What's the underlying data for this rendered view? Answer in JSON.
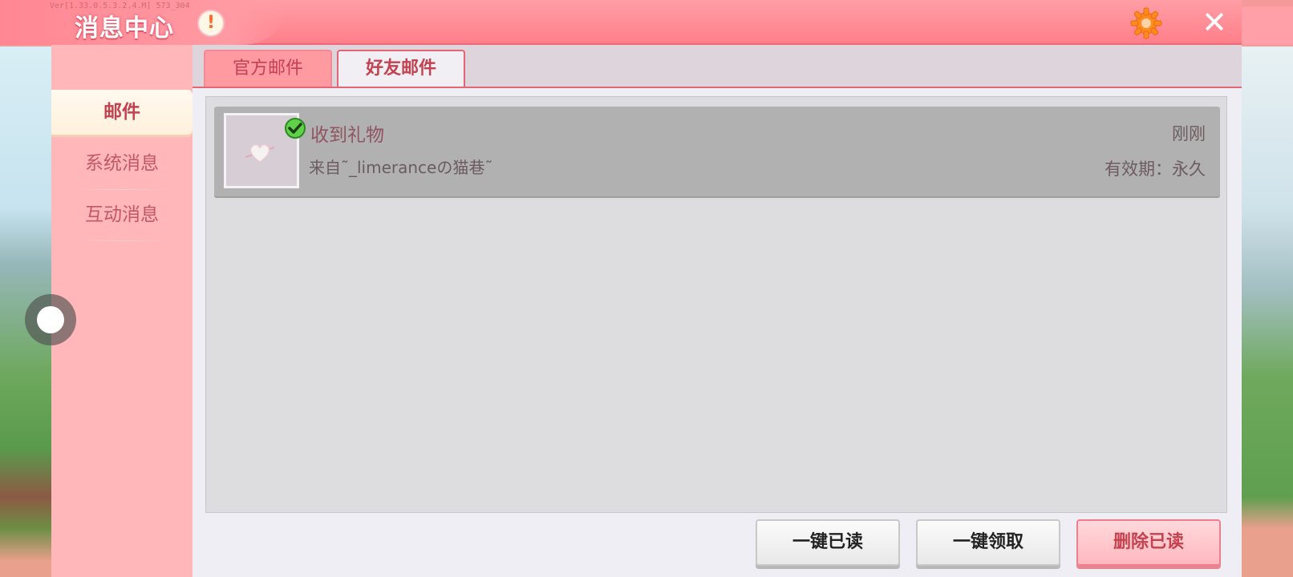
{
  "window": {
    "title": "消息中心",
    "version_text": "Ver[1.33.0.5.3.2.4.M] 573_304",
    "alert_symbol": "!",
    "close_symbol": "✕"
  },
  "sidebar": {
    "items": [
      {
        "label": "邮件",
        "active": true
      },
      {
        "label": "系统消息",
        "active": false
      },
      {
        "label": "互动消息",
        "active": false
      }
    ]
  },
  "tabs": [
    {
      "label": "官方邮件",
      "active": false
    },
    {
      "label": "好友邮件",
      "active": true
    }
  ],
  "mails": [
    {
      "subject": "收到礼物",
      "sender": "来自˜_limeranceの猫巷˜",
      "time": "刚刚",
      "expiry": "有效期：永久",
      "icon": "heart-icon",
      "status_icon": "check-icon"
    }
  ],
  "actions": {
    "read_all": "一键已读",
    "claim_all": "一键领取",
    "delete_read": "删除已读"
  },
  "colors": {
    "title_bar": "#ff7f8a",
    "sidebar": "#ffb7b9",
    "accent": "#c4414f"
  }
}
